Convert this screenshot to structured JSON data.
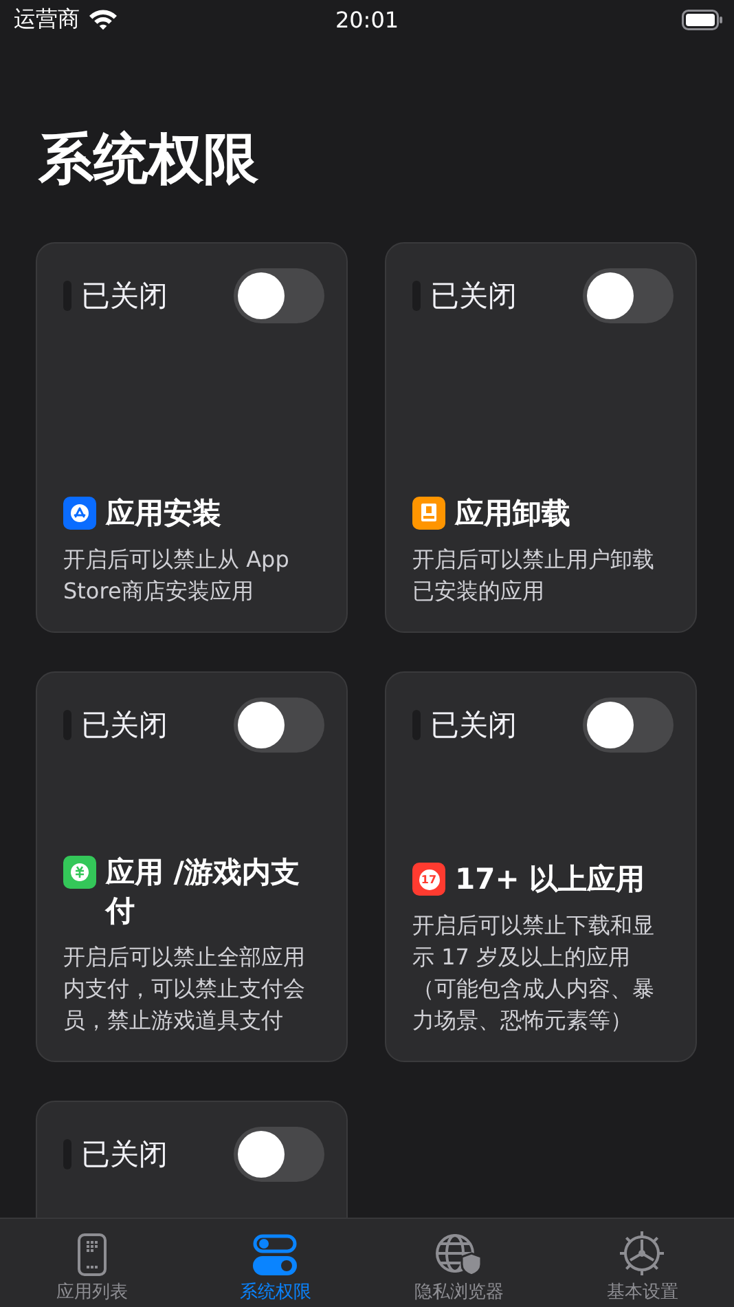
{
  "status_bar": {
    "carrier": "运营商",
    "time": "20:01"
  },
  "title": "系统权限",
  "cards": [
    {
      "status": "已关闭",
      "on": false,
      "kind": "appstore",
      "color": "#0a6cff",
      "title": "应用安装",
      "description": "开启后可以禁止从 App Store商店安装应用"
    },
    {
      "status": "已关闭",
      "on": false,
      "kind": "uninstall",
      "color": "#ff9500",
      "title": "应用卸载",
      "description": "开启后可以禁止用户卸载已安装的应用"
    },
    {
      "status": "已关闭",
      "on": false,
      "kind": "payment",
      "color": "#34c759",
      "title": "应用 /游戏内支付",
      "description": "开启后可以禁止全部应用内支付，可以禁止支付会员，禁止游戏道具支付"
    },
    {
      "status": "已关闭",
      "on": false,
      "kind": "age",
      "color": "#ff3b30",
      "icon_text": "17",
      "title": "17+ 以上应用",
      "description": "开启后可以禁止下载和显示 17 岁及以上的应用（可能包含成人内容、暴力场景、恐怖元素等）"
    },
    {
      "status": "已关闭",
      "on": false
    }
  ],
  "tabs": [
    {
      "kind": "apps",
      "label": "应用列表",
      "selected": false
    },
    {
      "kind": "permissions",
      "label": "系统权限",
      "selected": true
    },
    {
      "kind": "browser",
      "label": "隐私浏览器",
      "selected": false
    },
    {
      "kind": "settings",
      "label": "基本设置",
      "selected": false
    }
  ]
}
